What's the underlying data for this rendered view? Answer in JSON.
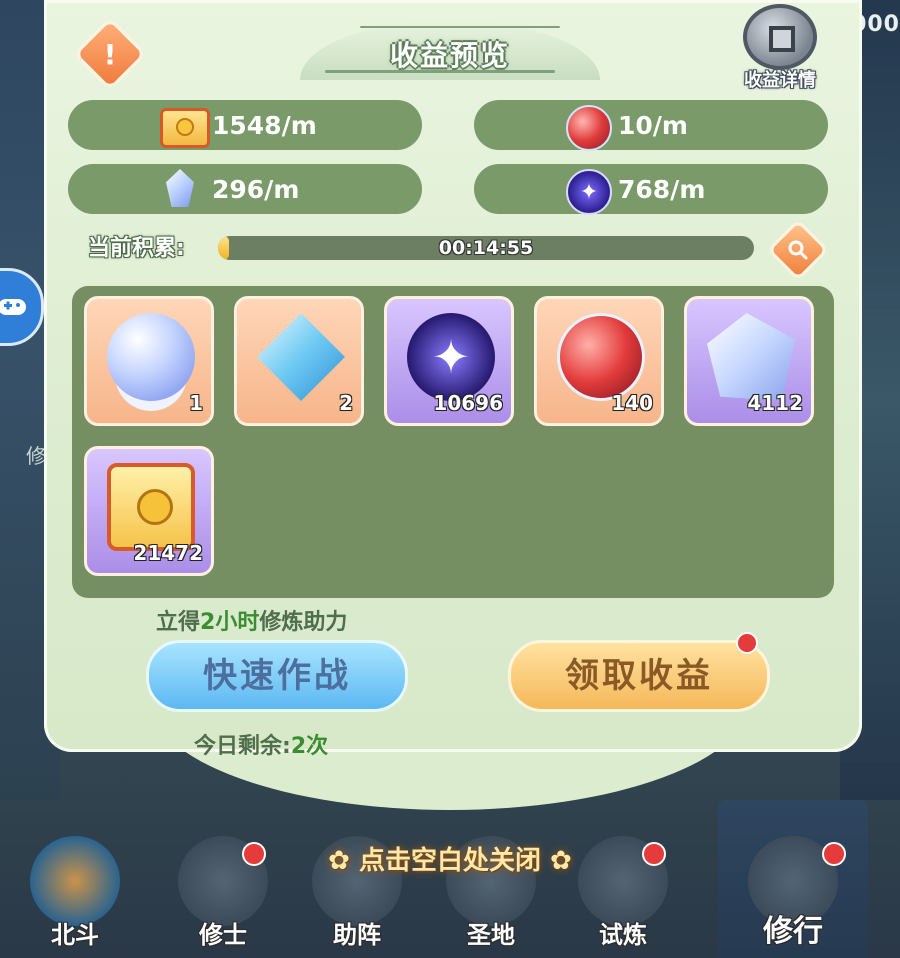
{
  "dialog": {
    "title": "收益预览",
    "detail_button_label": "收益详情",
    "rates": [
      {
        "icon": "gold-scroll-icon",
        "value": "1548/m"
      },
      {
        "icon": "red-orb-icon",
        "value": "10/m"
      },
      {
        "icon": "crystal-icon",
        "value": "296/m"
      },
      {
        "icon": "star-orb-icon",
        "value": "768/m"
      }
    ],
    "accumulated_label": "当前积累:",
    "accumulated_time": "00:14:55",
    "accumulated_progress": 0.02,
    "items": [
      {
        "icon": "pearl-icon",
        "count": "1",
        "rarity": "orange"
      },
      {
        "icon": "diamond-gem-icon",
        "count": "2",
        "rarity": "orange"
      },
      {
        "icon": "star-orb-icon",
        "count": "10696",
        "rarity": "purple"
      },
      {
        "icon": "red-orb-icon",
        "count": "140",
        "rarity": "orange"
      },
      {
        "icon": "crystal-icon",
        "count": "4112",
        "rarity": "purple"
      },
      {
        "icon": "gold-scroll-icon",
        "count": "21472",
        "rarity": "purple"
      }
    ],
    "boost_prefix": "立得",
    "boost_highlight": "2小时",
    "boost_suffix": "修炼助力",
    "quick_battle_label": "快速作战",
    "collect_label": "领取收益",
    "remaining_prefix": "今日剩余:",
    "remaining_value": "2次"
  },
  "close_hint": "点击空白处关闭",
  "background": {
    "side_text": "修",
    "top_right_counter": "000"
  },
  "nav": {
    "items": [
      {
        "label": "北斗"
      },
      {
        "label": "修士"
      },
      {
        "label": "助阵"
      },
      {
        "label": "圣地"
      },
      {
        "label": "试炼"
      },
      {
        "label": "修行"
      }
    ]
  },
  "colors": {
    "panel": "#dceccf",
    "pill": "#7a9a6a",
    "grid": "#758f63",
    "accent_green": "#3c8c32",
    "alert_red": "#e53b3b"
  }
}
